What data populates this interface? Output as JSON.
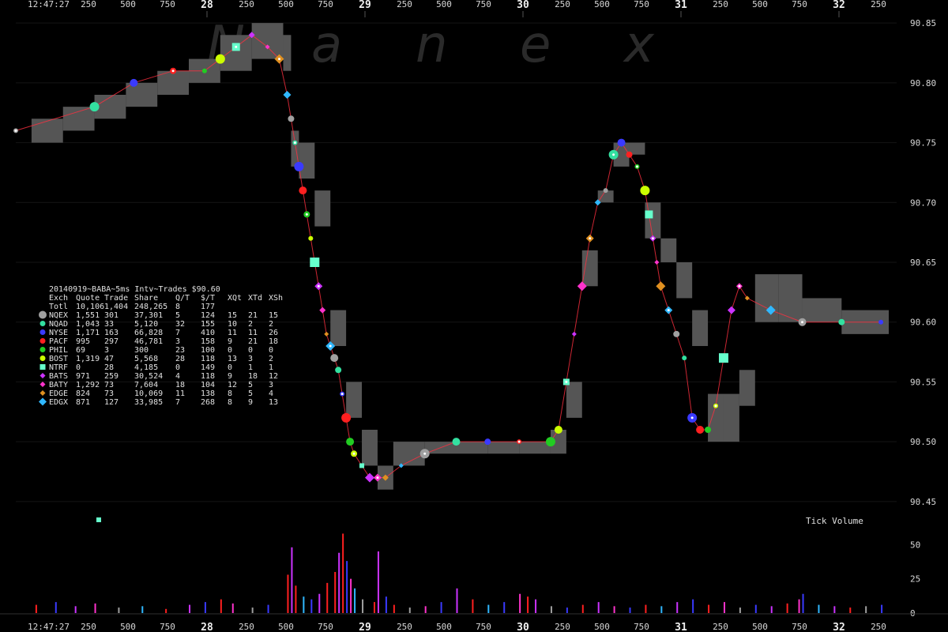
{
  "chart_data": {
    "type": "scatter",
    "title": "20140919~BABA~5ms Intv~Trades $90.60",
    "watermark": "Nanex",
    "x_axis": {
      "start_time": "12:47:27",
      "ticks": [
        "250",
        "500",
        "750",
        "28",
        "250",
        "500",
        "750",
        "29",
        "250",
        "500",
        "750",
        "30",
        "250",
        "500",
        "750",
        "31",
        "250",
        "500",
        "750",
        "32",
        "250"
      ],
      "major_ticks": [
        "28",
        "29",
        "30",
        "31",
        "32"
      ]
    },
    "y_axis": {
      "price_ticks": [
        "90.85",
        "90.80",
        "90.75",
        "90.70",
        "90.65",
        "90.60",
        "90.55",
        "90.50",
        "90.45"
      ],
      "ylim": [
        90.44,
        90.86
      ],
      "volume_label": "Tick Volume",
      "volume_ticks": [
        "50",
        "25",
        "0"
      ],
      "volume_lim": [
        0,
        60
      ]
    },
    "legend": {
      "header": [
        "Exch",
        "Quote",
        "Trade",
        "Share",
        "Q/T",
        "$/T",
        "XQt",
        "XTd",
        "XSh"
      ],
      "totals": [
        "Totl",
        "10,106",
        "1,404",
        "248,265",
        "8",
        "177",
        "",
        "",
        ""
      ],
      "rows": [
        {
          "exch": "NQEX",
          "quote": "1,551",
          "trade": "301",
          "share": "37,301",
          "qt": "5",
          "st": "124",
          "xqt": "15",
          "xtd": "21",
          "xsh": "15",
          "color": "#a0a0a0",
          "shape": "circle"
        },
        {
          "exch": "NQAD",
          "quote": "1,043",
          "trade": "33",
          "share": "5,120",
          "qt": "32",
          "st": "155",
          "xqt": "10",
          "xtd": "2",
          "xsh": "2",
          "color": "#33e0a0",
          "shape": "circle"
        },
        {
          "exch": "NYSE",
          "quote": "1,171",
          "trade": "163",
          "share": "66,828",
          "qt": "7",
          "st": "410",
          "xqt": "11",
          "xtd": "11",
          "xsh": "26",
          "color": "#3a3aff",
          "shape": "circle"
        },
        {
          "exch": "PACF",
          "quote": "995",
          "trade": "297",
          "share": "46,781",
          "qt": "3",
          "st": "158",
          "xqt": "9",
          "xtd": "21",
          "xsh": "18",
          "color": "#ff2020",
          "shape": "circle"
        },
        {
          "exch": "PHIL",
          "quote": "69",
          "trade": "3",
          "share": "300",
          "qt": "23",
          "st": "100",
          "xqt": "0",
          "xtd": "0",
          "xsh": "0",
          "color": "#22cc22",
          "shape": "circle"
        },
        {
          "exch": "BOST",
          "quote": "1,319",
          "trade": "47",
          "share": "5,568",
          "qt": "28",
          "st": "118",
          "xqt": "13",
          "xtd": "3",
          "xsh": "2",
          "color": "#ccff00",
          "shape": "circle"
        },
        {
          "exch": "NTRF",
          "quote": "0",
          "trade": "28",
          "share": "4,185",
          "qt": "0",
          "st": "149",
          "xqt": "0",
          "xtd": "1",
          "xsh": "1",
          "color": "#66ffcc",
          "shape": "square"
        },
        {
          "exch": "BATS",
          "quote": "971",
          "trade": "259",
          "share": "30,524",
          "qt": "4",
          "st": "118",
          "xqt": "9",
          "xtd": "18",
          "xsh": "12",
          "color": "#cc33ff",
          "shape": "diamond"
        },
        {
          "exch": "BATY",
          "quote": "1,292",
          "trade": "73",
          "share": "7,604",
          "qt": "18",
          "st": "104",
          "xqt": "12",
          "xtd": "5",
          "xsh": "3",
          "color": "#ff33cc",
          "shape": "diamond"
        },
        {
          "exch": "EDGE",
          "quote": "824",
          "trade": "73",
          "share": "10,069",
          "qt": "11",
          "st": "138",
          "xqt": "8",
          "xtd": "5",
          "xsh": "4",
          "color": "#e09020",
          "shape": "diamond"
        },
        {
          "exch": "EDGX",
          "quote": "871",
          "trade": "127",
          "share": "33,985",
          "qt": "7",
          "st": "268",
          "xqt": "8",
          "xtd": "9",
          "xsh": "13",
          "color": "#30b8ff",
          "shape": "diamond"
        }
      ]
    },
    "trade_path": {
      "x": [
        0,
        100,
        150,
        200,
        240,
        260,
        280,
        300,
        320,
        335,
        345,
        350,
        355,
        360,
        365,
        370,
        375,
        380,
        385,
        390,
        395,
        400,
        405,
        410,
        415,
        420,
        425,
        430,
        440,
        450,
        460,
        470,
        490,
        520,
        560,
        600,
        640,
        680,
        690,
        700,
        710,
        720,
        730,
        740,
        750,
        760,
        770,
        780,
        790,
        800,
        805,
        810,
        815,
        820,
        830,
        840,
        850,
        860,
        870,
        880,
        890,
        900,
        910,
        920,
        930,
        960,
        1000,
        1050,
        1100
      ],
      "y": [
        90.76,
        90.78,
        90.8,
        90.81,
        90.81,
        90.82,
        90.83,
        90.84,
        90.83,
        90.82,
        90.79,
        90.77,
        90.75,
        90.73,
        90.71,
        90.69,
        90.67,
        90.65,
        90.63,
        90.61,
        90.59,
        90.58,
        90.57,
        90.56,
        90.54,
        90.52,
        90.5,
        90.49,
        90.48,
        90.47,
        90.47,
        90.47,
        90.48,
        90.49,
        90.5,
        90.5,
        90.5,
        90.5,
        90.51,
        90.55,
        90.59,
        90.63,
        90.67,
        90.7,
        90.71,
        90.74,
        90.75,
        90.74,
        90.73,
        90.71,
        90.69,
        90.67,
        90.65,
        90.63,
        90.61,
        90.59,
        90.57,
        90.52,
        90.51,
        90.51,
        90.53,
        90.57,
        90.61,
        90.63,
        90.62,
        90.61,
        90.6,
        90.6,
        90.6
      ]
    },
    "nbbo_band": {
      "x": [
        20,
        60,
        100,
        140,
        180,
        220,
        260,
        300,
        340,
        350,
        360,
        380,
        400,
        420,
        440,
        460,
        480,
        520,
        560,
        600,
        640,
        680,
        700,
        720,
        740,
        760,
        780,
        800,
        820,
        840,
        860,
        880,
        900,
        920,
        940,
        970,
        1000,
        1050,
        1110
      ],
      "low": [
        90.75,
        90.76,
        90.77,
        90.78,
        90.79,
        90.8,
        90.81,
        90.82,
        90.81,
        90.73,
        90.72,
        90.68,
        90.58,
        90.52,
        90.48,
        90.46,
        90.48,
        90.49,
        90.49,
        90.49,
        90.49,
        90.49,
        90.52,
        90.63,
        90.7,
        90.73,
        90.74,
        90.67,
        90.65,
        90.62,
        90.58,
        90.5,
        90.5,
        90.53,
        90.6,
        90.6,
        90.6,
        90.59,
        90.59
      ],
      "high": [
        90.77,
        90.78,
        90.79,
        90.8,
        90.81,
        90.82,
        90.84,
        90.85,
        90.84,
        90.76,
        90.75,
        90.71,
        90.61,
        90.55,
        90.51,
        90.48,
        90.5,
        90.5,
        90.5,
        90.5,
        90.5,
        90.51,
        90.55,
        90.66,
        90.71,
        90.75,
        90.75,
        90.7,
        90.67,
        90.65,
        90.61,
        90.54,
        90.54,
        90.56,
        90.64,
        90.64,
        90.62,
        90.61,
        90.61
      ]
    },
    "tick_volume": {
      "x": [
        25,
        50,
        75,
        100,
        130,
        160,
        190,
        220,
        240,
        260,
        275,
        300,
        320,
        345,
        350,
        355,
        365,
        375,
        385,
        395,
        405,
        410,
        415,
        420,
        425,
        430,
        440,
        455,
        460,
        470,
        480,
        500,
        520,
        540,
        560,
        580,
        600,
        620,
        640,
        650,
        660,
        680,
        700,
        720,
        740,
        760,
        780,
        800,
        820,
        840,
        860,
        880,
        900,
        920,
        940,
        960,
        980,
        995,
        1000,
        1020,
        1040,
        1060,
        1080,
        1100
      ],
      "values": [
        6,
        8,
        5,
        7,
        4,
        5,
        3,
        6,
        8,
        10,
        7,
        4,
        6,
        28,
        48,
        20,
        12,
        10,
        14,
        22,
        30,
        44,
        58,
        38,
        25,
        18,
        10,
        8,
        45,
        12,
        6,
        4,
        5,
        8,
        18,
        10,
        6,
        8,
        14,
        12,
        10,
        5,
        4,
        6,
        8,
        5,
        4,
        6,
        5,
        8,
        10,
        6,
        8,
        4,
        6,
        5,
        7,
        10,
        14,
        6,
        5,
        4,
        5,
        6
      ],
      "colors": [
        "#ff2020",
        "#3a3aff",
        "#cc33ff",
        "#ff33cc",
        "#a0a0a0",
        "#30b8ff",
        "#ff2020",
        "#cc33ff",
        "#3a3aff",
        "#ff2020",
        "#ff33cc",
        "#a0a0a0",
        "#3a3aff",
        "#ff2020",
        "#cc33ff",
        "#ff2020",
        "#30b8ff",
        "#3a3aff",
        "#cc33ff",
        "#ff2020",
        "#ff2020",
        "#cc33ff",
        "#ff2020",
        "#3a3aff",
        "#ff33cc",
        "#30b8ff",
        "#a0a0a0",
        "#ff2020",
        "#cc33ff",
        "#3a3aff",
        "#ff2020",
        "#a0a0a0",
        "#ff33cc",
        "#3a3aff",
        "#cc33ff",
        "#ff2020",
        "#30b8ff",
        "#3a3aff",
        "#ff33cc",
        "#ff2020",
        "#cc33ff",
        "#a0a0a0",
        "#3a3aff",
        "#ff2020",
        "#cc33ff",
        "#ff33cc",
        "#3a3aff",
        "#ff2020",
        "#30b8ff",
        "#cc33ff",
        "#3a3aff",
        "#ff2020",
        "#ff33cc",
        "#a0a0a0",
        "#3a3aff",
        "#cc33ff",
        "#ff2020",
        "#ff33cc",
        "#3a3aff",
        "#30b8ff",
        "#cc33ff",
        "#ff2020",
        "#a0a0a0",
        "#3a3aff"
      ]
    }
  }
}
